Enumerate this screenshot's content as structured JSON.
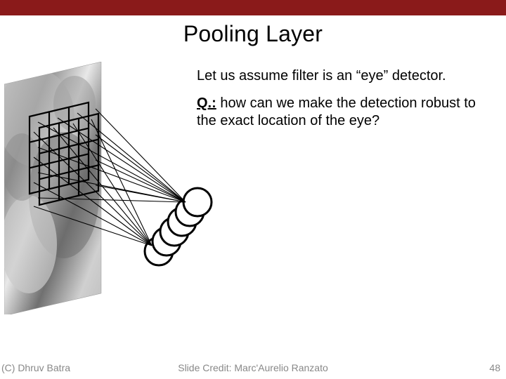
{
  "title": "Pooling Layer",
  "body": {
    "line1": "Let us assume filter is an “eye” detector.",
    "q_label": "Q.:",
    "q_rest": " how can we make the detection robust to the exact location of the eye?"
  },
  "footer": {
    "left": "(C) Dhruv Batra",
    "center": "Slide Credit: Marc'Aurelio Ranzato",
    "right": "48"
  }
}
